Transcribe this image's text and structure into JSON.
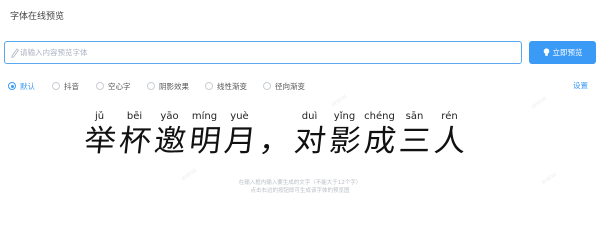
{
  "panel": {
    "title": "字体在线预览"
  },
  "search": {
    "placeholder": "请输入内容预览字体",
    "value": "",
    "icon": "pen-icon"
  },
  "preview_button": {
    "label": "立即预览",
    "icon": "bulb-icon"
  },
  "effects": [
    {
      "label": "默认",
      "selected": true
    },
    {
      "label": "抖音",
      "selected": false
    },
    {
      "label": "空心字",
      "selected": false
    },
    {
      "label": "阴影效果",
      "selected": false
    },
    {
      "label": "线性渐变",
      "selected": false
    },
    {
      "label": "径向渐变",
      "selected": false
    }
  ],
  "settings_label": "设置",
  "preview": {
    "chars": [
      {
        "hz": "举",
        "py": "jǔ"
      },
      {
        "hz": "杯",
        "py": "bēi"
      },
      {
        "hz": "邀",
        "py": "yāo"
      },
      {
        "hz": "明",
        "py": "míng"
      },
      {
        "hz": "月",
        "py": "yuè"
      },
      {
        "hz": "，",
        "py": ""
      },
      {
        "hz": "对",
        "py": "duì"
      },
      {
        "hz": "影",
        "py": "yǐng"
      },
      {
        "hz": "成",
        "py": "chéng"
      },
      {
        "hz": "三",
        "py": "sān"
      },
      {
        "hz": "人",
        "py": "rén"
      }
    ]
  },
  "hints": {
    "line1": "在输入框内输入要生成的文字（不能大于12个字）",
    "line2": "点击右边的按钮即可生成该字体的预览图"
  },
  "colors": {
    "accent": "#3b9af5",
    "border": "#5aa8f0"
  }
}
